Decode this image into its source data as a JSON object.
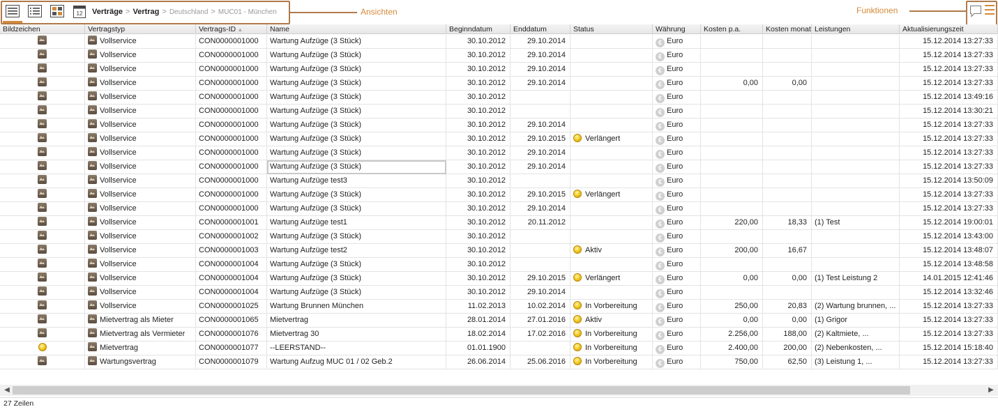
{
  "toolbar": {
    "views": [
      {
        "icon": "list-view-icon",
        "active": true
      },
      {
        "icon": "detail-list-view-icon",
        "active": false
      },
      {
        "icon": "tile-view-icon",
        "active": false
      },
      {
        "icon": "calendar-view-icon",
        "active": false,
        "badge": "12"
      }
    ],
    "breadcrumb": {
      "level1": "Verträge",
      "level2": "Vertrag",
      "level3": "Deutschland",
      "level4": "MUC01 - München",
      "separator": ">"
    },
    "annotations": {
      "views_label": "Ansichten",
      "functions_label": "Funktionen"
    }
  },
  "colors": {
    "accent": "#d58a3a",
    "annotation_border": "#b07a4a"
  },
  "table": {
    "columns": [
      "Bildzeichen",
      "Vertragstyp",
      "Vertrags-ID",
      "Name",
      "Beginndatum",
      "Enddatum",
      "Status",
      "Währung",
      "Kosten p.a.",
      "Kosten monat",
      "Leistungen",
      "Aktualisierungszeit"
    ],
    "sorted_column": "Vertrags-ID",
    "rows": [
      {
        "icon": "image",
        "type": "Vollservice",
        "id": "CON0000001000",
        "name": "Wartung Aufzüge (3 Stück)",
        "begin": "30.10.2012",
        "end": "29.10.2014",
        "status": "",
        "currency": "Euro",
        "cost_pa": "",
        "cost_month": "",
        "services": "",
        "updated": "15.12.2014 13:27:33"
      },
      {
        "icon": "image",
        "type": "Vollservice",
        "id": "CON0000001000",
        "name": "Wartung Aufzüge (3 Stück)",
        "begin": "30.10.2012",
        "end": "29.10.2014",
        "status": "",
        "currency": "Euro",
        "cost_pa": "",
        "cost_month": "",
        "services": "",
        "updated": "15.12.2014 13:27:33"
      },
      {
        "icon": "image",
        "type": "Vollservice",
        "id": "CON0000001000",
        "name": "Wartung Aufzüge (3 Stück)",
        "begin": "30.10.2012",
        "end": "29.10.2014",
        "status": "",
        "currency": "Euro",
        "cost_pa": "",
        "cost_month": "",
        "services": "",
        "updated": "15.12.2014 13:27:33"
      },
      {
        "icon": "image",
        "type": "Vollservice",
        "id": "CON0000001000",
        "name": "Wartung Aufzüge (3 Stück)",
        "begin": "30.10.2012",
        "end": "29.10.2014",
        "status": "",
        "currency": "Euro",
        "cost_pa": "0,00",
        "cost_month": "0,00",
        "services": "",
        "updated": "15.12.2014 13:27:33"
      },
      {
        "icon": "image",
        "type": "Vollservice",
        "id": "CON0000001000",
        "name": "Wartung Aufzüge (3 Stück)",
        "begin": "30.10.2012",
        "end": "",
        "status": "",
        "currency": "Euro",
        "cost_pa": "",
        "cost_month": "",
        "services": "",
        "updated": "15.12.2014 13:49:16"
      },
      {
        "icon": "image",
        "type": "Vollservice",
        "id": "CON0000001000",
        "name": "Wartung Aufzüge (3 Stück)",
        "begin": "30.10.2012",
        "end": "",
        "status": "",
        "currency": "Euro",
        "cost_pa": "",
        "cost_month": "",
        "services": "",
        "updated": "15.12.2014 13:30:21"
      },
      {
        "icon": "image",
        "type": "Vollservice",
        "id": "CON0000001000",
        "name": "Wartung Aufzüge (3 Stück)",
        "begin": "30.10.2012",
        "end": "29.10.2014",
        "status": "",
        "currency": "Euro",
        "cost_pa": "",
        "cost_month": "",
        "services": "",
        "updated": "15.12.2014 13:27:33"
      },
      {
        "icon": "image",
        "type": "Vollservice",
        "id": "CON0000001000",
        "name": "Wartung Aufzüge (3 Stück)",
        "begin": "30.10.2012",
        "end": "29.10.2015",
        "status": "Verlängert",
        "currency": "Euro",
        "cost_pa": "",
        "cost_month": "",
        "services": "",
        "updated": "15.12.2014 13:27:33"
      },
      {
        "icon": "image",
        "type": "Vollservice",
        "id": "CON0000001000",
        "name": "Wartung Aufzüge (3 Stück)",
        "begin": "30.10.2012",
        "end": "29.10.2014",
        "status": "",
        "currency": "Euro",
        "cost_pa": "",
        "cost_month": "",
        "services": "",
        "updated": "15.12.2014 13:27:33"
      },
      {
        "icon": "image",
        "type": "Vollservice",
        "id": "CON0000001000",
        "name": "Wartung Aufzüge (3 Stück)",
        "begin": "30.10.2012",
        "end": "29.10.2014",
        "status": "",
        "currency": "Euro",
        "cost_pa": "",
        "cost_month": "",
        "services": "",
        "updated": "15.12.2014 13:27:33",
        "selected": true
      },
      {
        "icon": "image",
        "type": "Vollservice",
        "id": "CON0000001000",
        "name": "Wartung Aufzüge test3",
        "begin": "30.10.2012",
        "end": "",
        "status": "",
        "currency": "Euro",
        "cost_pa": "",
        "cost_month": "",
        "services": "",
        "updated": "15.12.2014 13:50:09"
      },
      {
        "icon": "image",
        "type": "Vollservice",
        "id": "CON0000001000",
        "name": "Wartung Aufzüge (3 Stück)",
        "begin": "30.10.2012",
        "end": "29.10.2015",
        "status": "Verlängert",
        "currency": "Euro",
        "cost_pa": "",
        "cost_month": "",
        "services": "",
        "updated": "15.12.2014 13:27:33"
      },
      {
        "icon": "image",
        "type": "Vollservice",
        "id": "CON0000001000",
        "name": "Wartung Aufzüge (3 Stück)",
        "begin": "30.10.2012",
        "end": "29.10.2014",
        "status": "",
        "currency": "Euro",
        "cost_pa": "",
        "cost_month": "",
        "services": "",
        "updated": "15.12.2014 13:27:33"
      },
      {
        "icon": "image",
        "type": "Vollservice",
        "id": "CON0000001001",
        "name": "Wartung Aufzüge test1",
        "begin": "30.10.2012",
        "end": "20.11.2012",
        "status": "",
        "currency": "Euro",
        "cost_pa": "220,00",
        "cost_month": "18,33",
        "services": "(1) Test",
        "updated": "15.12.2014 19:00:01"
      },
      {
        "icon": "image",
        "type": "Vollservice",
        "id": "CON0000001002",
        "name": "Wartung Aufzüge (3 Stück)",
        "begin": "30.10.2012",
        "end": "",
        "status": "",
        "currency": "Euro",
        "cost_pa": "",
        "cost_month": "",
        "services": "",
        "updated": "15.12.2014 13:43:00"
      },
      {
        "icon": "image",
        "type": "Vollservice",
        "id": "CON0000001003",
        "name": "Wartung Aufzüge test2",
        "begin": "30.10.2012",
        "end": "",
        "status": "Aktiv",
        "currency": "Euro",
        "cost_pa": "200,00",
        "cost_month": "16,67",
        "services": "",
        "updated": "15.12.2014 13:48:07"
      },
      {
        "icon": "image",
        "type": "Vollservice",
        "id": "CON0000001004",
        "name": "Wartung Aufzüge (3 Stück)",
        "begin": "30.10.2012",
        "end": "",
        "status": "",
        "currency": "Euro",
        "cost_pa": "",
        "cost_month": "",
        "services": "",
        "updated": "15.12.2014 13:48:58"
      },
      {
        "icon": "image",
        "type": "Vollservice",
        "id": "CON0000001004",
        "name": "Wartung Aufzüge (3 Stück)",
        "begin": "30.10.2012",
        "end": "29.10.2015",
        "status": "Verlängert",
        "currency": "Euro",
        "cost_pa": "0,00",
        "cost_month": "0,00",
        "services": "(1) Test Leistung 2",
        "updated": "14.01.2015 12:41:46"
      },
      {
        "icon": "image",
        "type": "Vollservice",
        "id": "CON0000001004",
        "name": "Wartung Aufzüge (3 Stück)",
        "begin": "30.10.2012",
        "end": "29.10.2014",
        "status": "",
        "currency": "Euro",
        "cost_pa": "",
        "cost_month": "",
        "services": "",
        "updated": "15.12.2014 13:32:46"
      },
      {
        "icon": "image",
        "type": "Vollservice",
        "id": "CON0000001025",
        "name": "Wartung Brunnen München",
        "begin": "11.02.2013",
        "end": "10.02.2014",
        "status": "In Vorbereitung",
        "currency": "Euro",
        "cost_pa": "250,00",
        "cost_month": "20,83",
        "services": "(2) Wartung brunnen, ...",
        "updated": "15.12.2014 13:27:33"
      },
      {
        "icon": "image",
        "type": "Mietvertrag als Mieter",
        "id": "CON0000001065",
        "name": "Mietvertrag",
        "begin": "28.01.2014",
        "end": "27.01.2016",
        "status": "Aktiv",
        "currency": "Euro",
        "cost_pa": "0,00",
        "cost_month": "0,00",
        "services": "(1) Grigor",
        "updated": "15.12.2014 13:27:33"
      },
      {
        "icon": "image",
        "type": "Mietvertrag als Vermieter",
        "id": "CON0000001076",
        "name": "Mietvertrag 30",
        "begin": "18.02.2014",
        "end": "17.02.2016",
        "status": "In Vorbereitung",
        "currency": "Euro",
        "cost_pa": "2.256,00",
        "cost_month": "188,00",
        "services": "(2) Kaltmiete, ...",
        "updated": "15.12.2014 13:27:33"
      },
      {
        "icon": "status",
        "type": "Mietvertrag",
        "id": "CON0000001077",
        "name": "--LEERSTAND--",
        "begin": "01.01.1900",
        "end": "",
        "status": "In Vorbereitung",
        "currency": "Euro",
        "cost_pa": "2.400,00",
        "cost_month": "200,00",
        "services": "(2) Nebenkosten, ...",
        "updated": "15.12.2014 15:18:40"
      },
      {
        "icon": "image",
        "type": "Wartungsvertrag",
        "id": "CON0000001079",
        "name": "Wartung Aufzug MUC 01 / 02 Geb.2",
        "begin": "26.06.2014",
        "end": "25.06.2016",
        "status": "In Vorbereitung",
        "currency": "Euro",
        "cost_pa": "750,00",
        "cost_month": "62,50",
        "services": "(3) Leistung 1, ...",
        "updated": "15.12.2014 13:27:33"
      }
    ]
  },
  "footer": {
    "row_count": "27 Zeilen"
  }
}
